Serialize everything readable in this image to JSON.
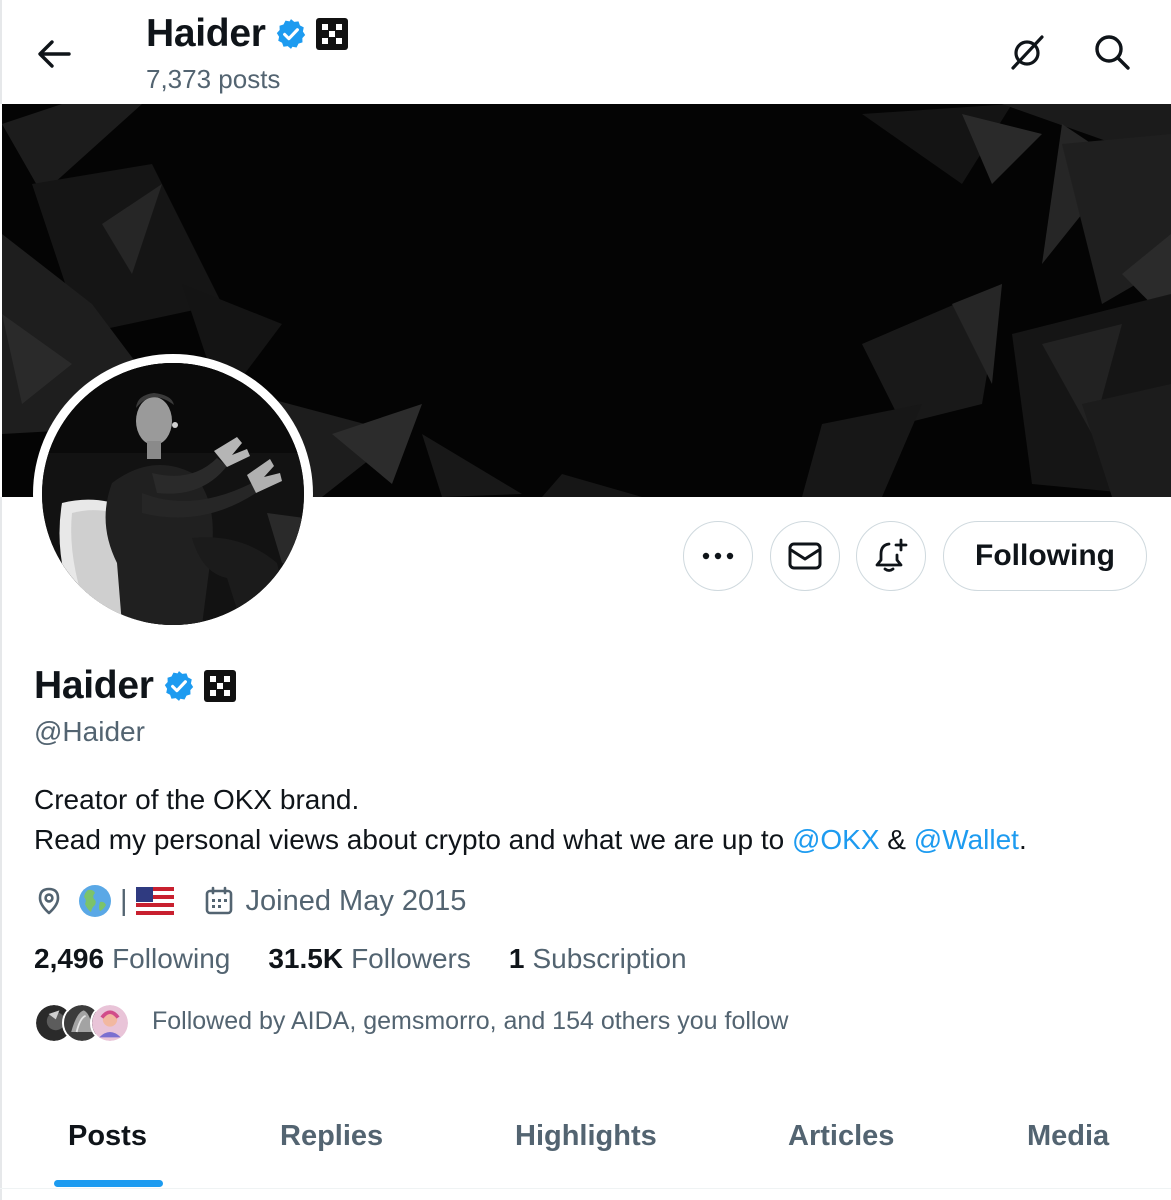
{
  "header": {
    "name": "Haider",
    "posts_count": "7,373 posts"
  },
  "profile": {
    "name": "Haider",
    "handle": "@Haider",
    "bio_line1": "Creator of the OKX brand.",
    "bio_line2_prefix": "Read my personal views about crypto and what we are up to ",
    "bio_mention1": "@OKX",
    "bio_amp": " & ",
    "bio_mention2": "@Wallet",
    "bio_period": ".",
    "location_separator": "|",
    "joined": "Joined May 2015",
    "following_count": "2,496",
    "following_label": "Following",
    "followers_count": "31.5K",
    "followers_label": "Followers",
    "subscriptions_count": "1",
    "subscriptions_label": "Subscription",
    "followed_by": "Followed by AIDA, gemsmorro, and 154 others you follow"
  },
  "actions": {
    "more_icon": "more-icon",
    "message_icon": "mail-icon",
    "notify_icon": "bell-plus-icon",
    "following_label": "Following"
  },
  "tabs": [
    {
      "label": "Posts",
      "active": true
    },
    {
      "label": "Replies",
      "active": false
    },
    {
      "label": "Highlights",
      "active": false
    },
    {
      "label": "Articles",
      "active": false
    },
    {
      "label": "Media",
      "active": false
    }
  ],
  "colors": {
    "accent": "#1d9bf0",
    "verified": "#1d9bf0",
    "secondary_text": "#536471",
    "primary_text": "#0f1419"
  }
}
